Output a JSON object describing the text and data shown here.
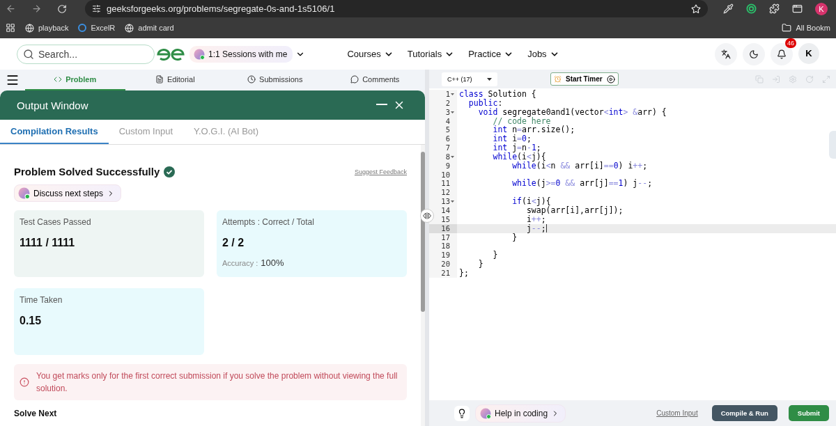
{
  "browser": {
    "url": "geeksforgeeks.org/problems/segregate-0s-and-1s5106/1",
    "profile": "K",
    "all_bookmarks": "All Bookm",
    "bookmarks": [
      {
        "label": "playback",
        "kind": "globe"
      },
      {
        "label": "ExcelR",
        "kind": "site"
      },
      {
        "label": "admit card",
        "kind": "globe"
      }
    ]
  },
  "header": {
    "search": {
      "placeholder": "Search..."
    },
    "sessions": "1:1 Sessions with me",
    "notifications": "46",
    "avatar": "K",
    "nav": [
      {
        "label": "Courses"
      },
      {
        "label": "Tutorials"
      },
      {
        "label": "Practice"
      },
      {
        "label": "Jobs"
      }
    ]
  },
  "problem_tabs": [
    {
      "label": "Problem",
      "kind": "code",
      "selected": true
    },
    {
      "label": "Editorial",
      "kind": "doc",
      "selected": false
    },
    {
      "label": "Submissions",
      "kind": "clock",
      "selected": false
    },
    {
      "label": "Comments",
      "kind": "chat",
      "selected": false
    }
  ],
  "output_window": {
    "title": "Output Window",
    "tabs": [
      {
        "label": "Compilation Results",
        "selected": true
      },
      {
        "label": "Custom Input",
        "selected": false
      },
      {
        "label": "Y.O.G.I. (AI Bot)",
        "selected": false
      }
    ],
    "status": "Problem Solved Successfully",
    "feedback": "Suggest Feedback",
    "discuss": "Discuss next steps",
    "stats": [
      {
        "label": "Test Cases Passed",
        "value": "1111 / 1111",
        "color": "#eef5f3"
      },
      {
        "label": "Attempts : Correct / Total",
        "value": "2 / 2",
        "note_label": "Accuracy :",
        "note_value": "100%",
        "color": "#e8fafd"
      },
      {
        "label": "Time Taken",
        "value": "0.15",
        "color": "#e8fafd"
      }
    ],
    "warning": "You get marks only for the first correct submission if you solve the problem without viewing the full solution.",
    "next_heading": "Solve Next"
  },
  "editor": {
    "language": "C++ (17)",
    "timer": "Start Timer",
    "help": "Help in coding",
    "custom_input": "Custom Input",
    "compile": "Compile & Run",
    "submit": "Submit",
    "lines": [
      {
        "number": "1",
        "fold": true,
        "active": false,
        "tokens": [
          {
            "text": "class",
            "kind": "kw"
          },
          {
            "text": " Solution {",
            "kind": "p"
          }
        ]
      },
      {
        "number": "2",
        "fold": false,
        "active": false,
        "tokens": [
          {
            "text": "  public",
            "kind": "kw"
          },
          {
            "text": ":",
            "kind": "p"
          }
        ]
      },
      {
        "number": "3",
        "fold": true,
        "active": false,
        "tokens": [
          {
            "text": "    void",
            "kind": "kw"
          },
          {
            "text": " segregate0and1(vector",
            "kind": "p"
          },
          {
            "text": "<",
            "kind": "op"
          },
          {
            "text": "int",
            "kind": "kw"
          },
          {
            "text": ">",
            "kind": "op"
          },
          {
            "text": " &",
            "kind": "op"
          },
          {
            "text": "arr) {",
            "kind": "p"
          }
        ]
      },
      {
        "number": "4",
        "fold": false,
        "active": false,
        "tokens": [
          {
            "text": "       // code here",
            "kind": "cm"
          }
        ]
      },
      {
        "number": "5",
        "fold": false,
        "active": false,
        "tokens": [
          {
            "text": "       int",
            "kind": "kw"
          },
          {
            "text": " n",
            "kind": "p"
          },
          {
            "text": "=",
            "kind": "op"
          },
          {
            "text": "arr.size();",
            "kind": "p"
          }
        ]
      },
      {
        "number": "6",
        "fold": false,
        "active": false,
        "tokens": [
          {
            "text": "       int",
            "kind": "kw"
          },
          {
            "text": " i",
            "kind": "p"
          },
          {
            "text": "=",
            "kind": "op"
          },
          {
            "text": "0",
            "kind": "num"
          },
          {
            "text": ";",
            "kind": "p"
          }
        ]
      },
      {
        "number": "7",
        "fold": false,
        "active": false,
        "tokens": [
          {
            "text": "       int",
            "kind": "kw"
          },
          {
            "text": " j",
            "kind": "p"
          },
          {
            "text": "=",
            "kind": "op"
          },
          {
            "text": "n",
            "kind": "p"
          },
          {
            "text": "-",
            "kind": "op"
          },
          {
            "text": "1",
            "kind": "num"
          },
          {
            "text": ";",
            "kind": "p"
          }
        ]
      },
      {
        "number": "8",
        "fold": true,
        "active": false,
        "tokens": [
          {
            "text": "       while",
            "kind": "kw"
          },
          {
            "text": "(i",
            "kind": "p"
          },
          {
            "text": "<",
            "kind": "op"
          },
          {
            "text": "j){",
            "kind": "p"
          }
        ]
      },
      {
        "number": "9",
        "fold": false,
        "active": false,
        "tokens": [
          {
            "text": "           while",
            "kind": "kw"
          },
          {
            "text": "(i",
            "kind": "p"
          },
          {
            "text": "<",
            "kind": "op"
          },
          {
            "text": "n ",
            "kind": "p"
          },
          {
            "text": "&&",
            "kind": "op"
          },
          {
            "text": " arr[i]",
            "kind": "p"
          },
          {
            "text": "==",
            "kind": "op"
          },
          {
            "text": "0",
            "kind": "num"
          },
          {
            "text": ") i",
            "kind": "p"
          },
          {
            "text": "++",
            "kind": "op"
          },
          {
            "text": ";",
            "kind": "p"
          }
        ]
      },
      {
        "number": "10",
        "fold": false,
        "active": false
      },
      {
        "number": "11",
        "fold": false,
        "active": false,
        "tokens": [
          {
            "text": "           while",
            "kind": "kw"
          },
          {
            "text": "(j",
            "kind": "p"
          },
          {
            "text": ">=",
            "kind": "op"
          },
          {
            "text": "0",
            "kind": "num"
          },
          {
            "text": " &&",
            "kind": "op"
          },
          {
            "text": " arr[j]",
            "kind": "p"
          },
          {
            "text": "==",
            "kind": "op"
          },
          {
            "text": "1",
            "kind": "num"
          },
          {
            "text": ") j",
            "kind": "p"
          },
          {
            "text": "--",
            "kind": "op"
          },
          {
            "text": ";",
            "kind": "p"
          }
        ]
      },
      {
        "number": "12",
        "fold": false,
        "active": false
      },
      {
        "number": "13",
        "fold": true,
        "active": false,
        "tokens": [
          {
            "text": "           if",
            "kind": "kw"
          },
          {
            "text": "(i",
            "kind": "p"
          },
          {
            "text": "<",
            "kind": "op"
          },
          {
            "text": "j){",
            "kind": "p"
          }
        ]
      },
      {
        "number": "14",
        "fold": false,
        "active": false,
        "tokens": [
          {
            "text": "              swap(arr[i],arr[j]);",
            "kind": "p"
          }
        ]
      },
      {
        "number": "15",
        "fold": false,
        "active": false,
        "tokens": [
          {
            "text": "              i",
            "kind": "p"
          },
          {
            "text": "++",
            "kind": "op"
          },
          {
            "text": ";",
            "kind": "p"
          }
        ]
      },
      {
        "number": "16",
        "fold": false,
        "active": true,
        "tokens": [
          {
            "text": "              j",
            "kind": "p"
          },
          {
            "text": "--",
            "kind": "op"
          },
          {
            "text": ";",
            "kind": "p"
          }
        ]
      },
      {
        "number": "17",
        "fold": false,
        "active": false,
        "tokens": [
          {
            "text": "           }",
            "kind": "p"
          }
        ]
      },
      {
        "number": "18",
        "fold": false,
        "active": false
      },
      {
        "number": "19",
        "fold": false,
        "active": false,
        "tokens": [
          {
            "text": "       }",
            "kind": "p"
          }
        ]
      },
      {
        "number": "20",
        "fold": false,
        "active": false,
        "tokens": [
          {
            "text": "    }",
            "kind": "p"
          }
        ]
      },
      {
        "number": "21",
        "fold": false,
        "active": false,
        "tokens": [
          {
            "text": "};",
            "kind": "p"
          }
        ]
      }
    ]
  }
}
